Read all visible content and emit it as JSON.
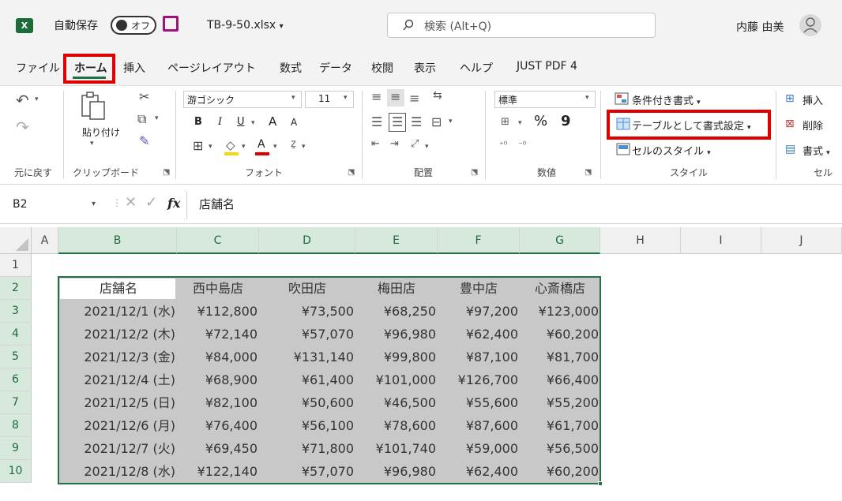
{
  "titlebar": {
    "app_icon": "X",
    "autosave_label": "自動保存",
    "autosave_state": "オフ",
    "filename": "TB-9-50.xlsx",
    "search_placeholder": "検索 (Alt+Q)",
    "user_name": "内藤 由美"
  },
  "tabs": [
    "ファイル",
    "ホーム",
    "挿入",
    "ページレイアウト",
    "数式",
    "データ",
    "校閲",
    "表示",
    "ヘルプ",
    "JUST PDF 4"
  ],
  "ribbon": {
    "undo_label": "元に戻す",
    "clipboard": {
      "paste": "貼り付け",
      "group": "クリップボード"
    },
    "font": {
      "name": "游ゴシック",
      "size": "11",
      "group": "フォント",
      "bold": "B",
      "italic": "I",
      "underline": "U",
      "grow": "A",
      "shrink": "A",
      "text_color": "A"
    },
    "alignment": {
      "group": "配置"
    },
    "number": {
      "format": "標準",
      "percent": "%",
      "comma": "9",
      "group": "数値"
    },
    "styles": {
      "conditional": "条件付き書式",
      "format_table": "テーブルとして書式設定",
      "cell_styles": "セルのスタイル",
      "group": "スタイル"
    },
    "cells": {
      "insert": "挿入",
      "delete": "削除",
      "format": "書式",
      "group": "セル"
    }
  },
  "formula_bar": {
    "name_box": "B2",
    "fx": "fx",
    "value": "店舗名"
  },
  "columns": [
    "A",
    "B",
    "C",
    "D",
    "E",
    "F",
    "G",
    "H",
    "I",
    "J"
  ],
  "rows": [
    "1",
    "2",
    "3",
    "4",
    "5",
    "6",
    "7",
    "8",
    "9",
    "10"
  ],
  "table": {
    "headers": [
      "店舗名",
      "西中島店",
      "吹田店",
      "梅田店",
      "豊中店",
      "心斎橋店"
    ],
    "data": [
      [
        "2021/12/1 (水)",
        "¥112,800",
        "¥73,500",
        "¥68,250",
        "¥97,200",
        "¥123,000"
      ],
      [
        "2021/12/2 (木)",
        "¥72,140",
        "¥57,070",
        "¥96,980",
        "¥62,400",
        "¥60,200"
      ],
      [
        "2021/12/3 (金)",
        "¥84,000",
        "¥131,140",
        "¥99,800",
        "¥87,100",
        "¥81,700"
      ],
      [
        "2021/12/4 (土)",
        "¥68,900",
        "¥61,400",
        "¥101,000",
        "¥126,700",
        "¥66,400"
      ],
      [
        "2021/12/5 (日)",
        "¥82,100",
        "¥50,600",
        "¥46,500",
        "¥55,600",
        "¥55,200"
      ],
      [
        "2021/12/6 (月)",
        "¥76,400",
        "¥56,100",
        "¥78,600",
        "¥87,600",
        "¥61,700"
      ],
      [
        "2021/12/7 (火)",
        "¥69,450",
        "¥71,800",
        "¥101,740",
        "¥59,000",
        "¥56,500"
      ],
      [
        "2021/12/8 (水)",
        "¥122,140",
        "¥57,070",
        "¥96,980",
        "¥62,400",
        "¥60,200"
      ]
    ]
  },
  "colors": {
    "excel_green": "#217346",
    "highlight_red": "#e00000",
    "selection_gray": "#c8c8c8"
  }
}
